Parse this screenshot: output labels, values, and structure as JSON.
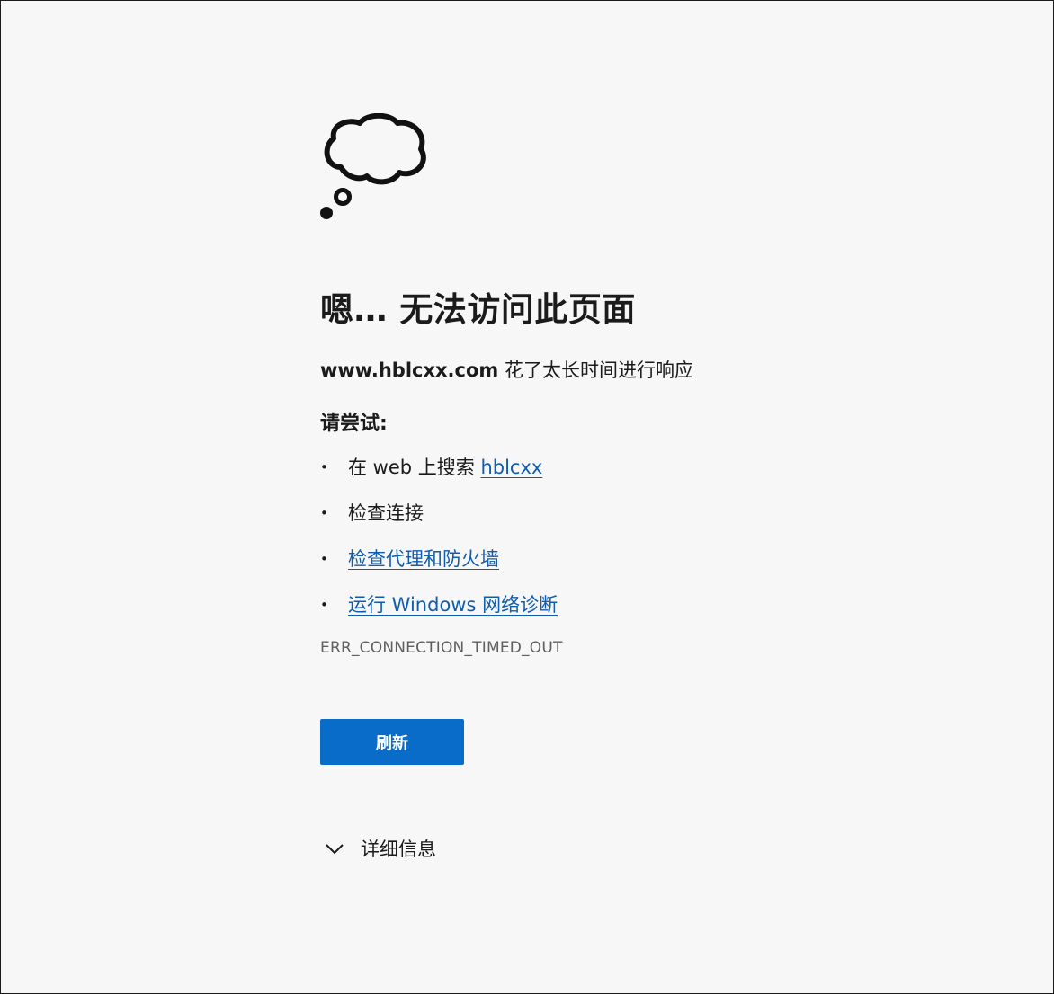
{
  "error": {
    "title": "嗯… 无法访问此页面",
    "host": "www.hblcxx.com",
    "message": "花了太长时间进行响应",
    "try_label": "请尝试:",
    "suggestions": [
      {
        "prefix": "在 web 上搜索 ",
        "link": "hblcxx"
      },
      {
        "text": "检查连接"
      },
      {
        "link": "检查代理和防火墙"
      },
      {
        "link": "运行 Windows 网络诊断"
      }
    ],
    "code": "ERR_CONNECTION_TIMED_OUT",
    "refresh_label": "刷新",
    "details_label": "详细信息"
  },
  "icons": {
    "illustration": "thought-cloud-icon",
    "details_toggle": "chevron-down-icon"
  },
  "colors": {
    "background": "#f7f7f7",
    "link": "#0f5db0",
    "button": "#0a6cc9",
    "code_text": "#5f5f5f"
  }
}
